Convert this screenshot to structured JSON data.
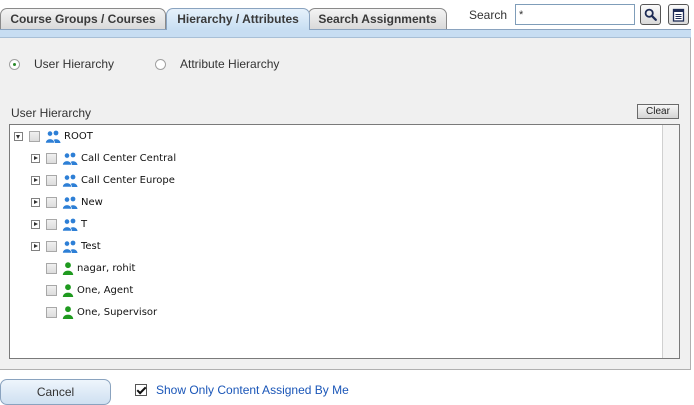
{
  "tabs": [
    {
      "label": "Course Groups / Courses",
      "active": false
    },
    {
      "label": "Hierarchy / Attributes",
      "active": true
    },
    {
      "label": "Search Assignments",
      "active": false
    }
  ],
  "search": {
    "label": "Search",
    "value": "*",
    "go_icon": "magnifier-icon",
    "results_icon": "notepad-icon"
  },
  "view_options": {
    "user_hierarchy": {
      "label": "User Hierarchy",
      "selected": true
    },
    "attribute_hierarchy": {
      "label": "Attribute Hierarchy",
      "selected": false
    }
  },
  "tree_section": {
    "title": "User Hierarchy",
    "clear_label": "Clear"
  },
  "tree": [
    {
      "label": "ROOT",
      "type": "group",
      "level": 0,
      "expander": "expanded"
    },
    {
      "label": "Call Center Central",
      "type": "group",
      "level": 1,
      "expander": "collapsed"
    },
    {
      "label": "Call Center Europe",
      "type": "group",
      "level": 1,
      "expander": "collapsed"
    },
    {
      "label": "New",
      "type": "group",
      "level": 1,
      "expander": "collapsed"
    },
    {
      "label": "T",
      "type": "group",
      "level": 1,
      "expander": "collapsed"
    },
    {
      "label": "Test",
      "type": "group",
      "level": 1,
      "expander": "collapsed"
    },
    {
      "label": "nagar, rohit",
      "type": "user",
      "level": 1,
      "expander": "none"
    },
    {
      "label": "One, Agent",
      "type": "user",
      "level": 1,
      "expander": "none"
    },
    {
      "label": "One, Supervisor",
      "type": "user",
      "level": 1,
      "expander": "none"
    }
  ],
  "footer": {
    "cancel_label": "Cancel",
    "show_only_label": "Show Only Content Assigned By Me",
    "show_only_checked": true
  },
  "colors": {
    "tab_active": "#c7def2",
    "panel_bg": "#f0f0f0",
    "group_icon": "#2d7fd6",
    "user_icon": "#1f9a1f",
    "link_text": "#1a56b8"
  }
}
